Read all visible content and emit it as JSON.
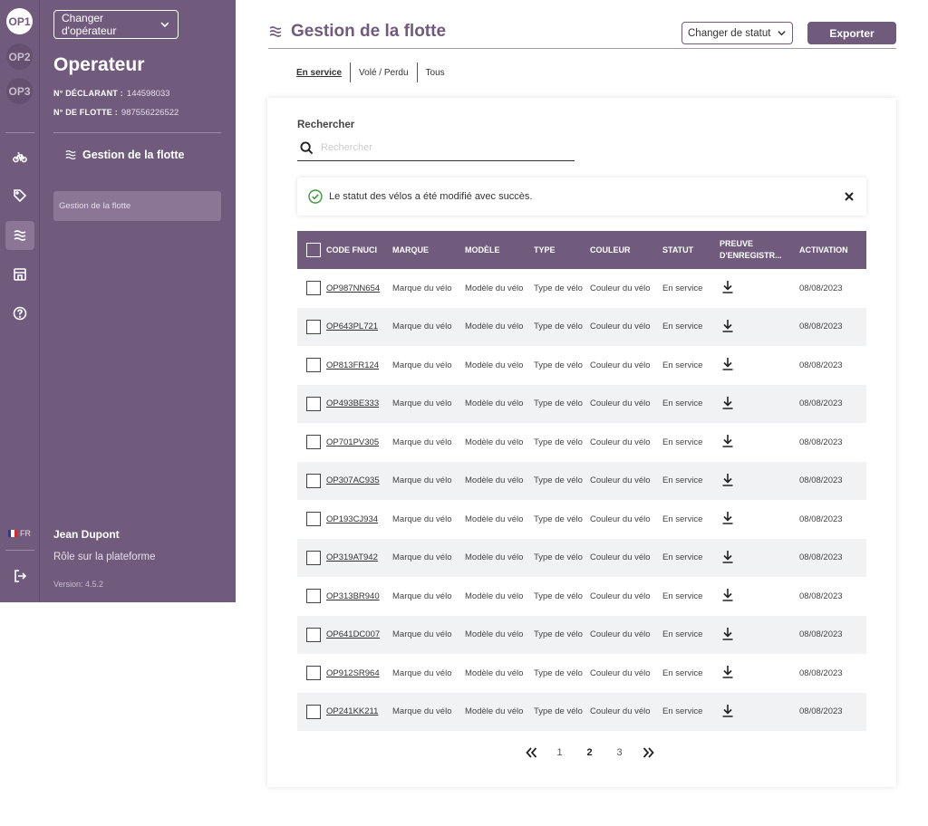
{
  "rail": {
    "operators": [
      "OP1",
      "OP2",
      "OP3"
    ],
    "language": "FR",
    "icons": [
      "bike-icon",
      "tag-icon",
      "fleet-icon",
      "store-icon",
      "help-icon",
      "logout-icon"
    ]
  },
  "sidebar": {
    "operator_select_label": "Changer d'opérateur",
    "operator_name": "Operateur",
    "declarant_label": "N° DÉCLARANT :",
    "declarant_value": "144598033",
    "fleet_label": "N° DE FLOTTE :",
    "fleet_value": "987556226522",
    "section_title": "Gestion de la flotte",
    "active_item": "Gestion de la flotte",
    "user_name": "Jean Dupont",
    "user_role": "Rôle sur la plateforme",
    "version": "Version: 4.5.2"
  },
  "header": {
    "title": "Gestion de la flotte",
    "status_select_label": "Changer de statut",
    "export_label": "Exporter"
  },
  "tabs": [
    {
      "label": "En service",
      "active": true
    },
    {
      "label": "Volé / Perdu",
      "active": false
    },
    {
      "label": "Tous",
      "active": false
    }
  ],
  "search": {
    "label": "Rechercher",
    "placeholder": "Rechercher",
    "value": ""
  },
  "alert": {
    "message": "Le statut des vélos a été modifié avec succès."
  },
  "table": {
    "columns": [
      "CODE FNUCI",
      "MARQUE",
      "MODÈLE",
      "TYPE",
      "COULEUR",
      "STATUT",
      "PREUVE D'ENREGISTR...",
      "ACTIVATION"
    ],
    "rows": [
      {
        "code": "OP987NN654",
        "marque": "Marque du vélo",
        "modele": "Modèle du vélo",
        "type": "Type de vélo",
        "couleur": "Couleur du vélo",
        "statut": "En service",
        "activation": "08/08/2023"
      },
      {
        "code": "OP643PL721",
        "marque": "Marque du vélo",
        "modele": "Modèle du vélo",
        "type": "Type de vélo",
        "couleur": "Couleur du vélo",
        "statut": "En service",
        "activation": "08/08/2023"
      },
      {
        "code": "OP813FR124",
        "marque": "Marque du vélo",
        "modele": "Modèle du vélo",
        "type": "Type de vélo",
        "couleur": "Couleur du vélo",
        "statut": "En service",
        "activation": "08/08/2023"
      },
      {
        "code": "OP493BE333",
        "marque": "Marque du vélo",
        "modele": "Modèle du vélo",
        "type": "Type de vélo",
        "couleur": "Couleur du vélo",
        "statut": "En service",
        "activation": "08/08/2023"
      },
      {
        "code": "OP701PV305",
        "marque": "Marque du vélo",
        "modele": "Modèle du vélo",
        "type": "Type de vélo",
        "couleur": "Couleur du vélo",
        "statut": "En service",
        "activation": "08/08/2023"
      },
      {
        "code": "OP307AC935",
        "marque": "Marque du vélo",
        "modele": "Modèle du vélo",
        "type": "Type de vélo",
        "couleur": "Couleur du vélo",
        "statut": "En service",
        "activation": "08/08/2023"
      },
      {
        "code": "OP193CJ934",
        "marque": "Marque du vélo",
        "modele": "Modèle du vélo",
        "type": "Type de vélo",
        "couleur": "Couleur du vélo",
        "statut": "En service",
        "activation": "08/08/2023"
      },
      {
        "code": "OP319AT942",
        "marque": "Marque du vélo",
        "modele": "Modèle du vélo",
        "type": "Type de vélo",
        "couleur": "Couleur du vélo",
        "statut": "En service",
        "activation": "08/08/2023"
      },
      {
        "code": "OP313BR940",
        "marque": "Marque du vélo",
        "modele": "Modèle du vélo",
        "type": "Type de vélo",
        "couleur": "Couleur du vélo",
        "statut": "En service",
        "activation": "08/08/2023"
      },
      {
        "code": "OP641DC007",
        "marque": "Marque du vélo",
        "modele": "Modèle du vélo",
        "type": "Type de vélo",
        "couleur": "Couleur du vélo",
        "statut": "En service",
        "activation": "08/08/2023"
      },
      {
        "code": "OP912SR964",
        "marque": "Marque du vélo",
        "modele": "Modèle du vélo",
        "type": "Type de vélo",
        "couleur": "Couleur du vélo",
        "statut": "En service",
        "activation": "08/08/2023"
      },
      {
        "code": "OP241KK211",
        "marque": "Marque du vélo",
        "modele": "Modèle du vélo",
        "type": "Type de vélo",
        "couleur": "Couleur du vélo",
        "statut": "En service",
        "activation": "08/08/2023"
      }
    ]
  },
  "pagination": {
    "pages": [
      "1",
      "2",
      "3"
    ],
    "current": "2"
  },
  "colors": {
    "brand": "#715b7d",
    "brand_light": "#8b7696",
    "success": "#3c9a3a",
    "row_alt": "#f1f2f4"
  }
}
